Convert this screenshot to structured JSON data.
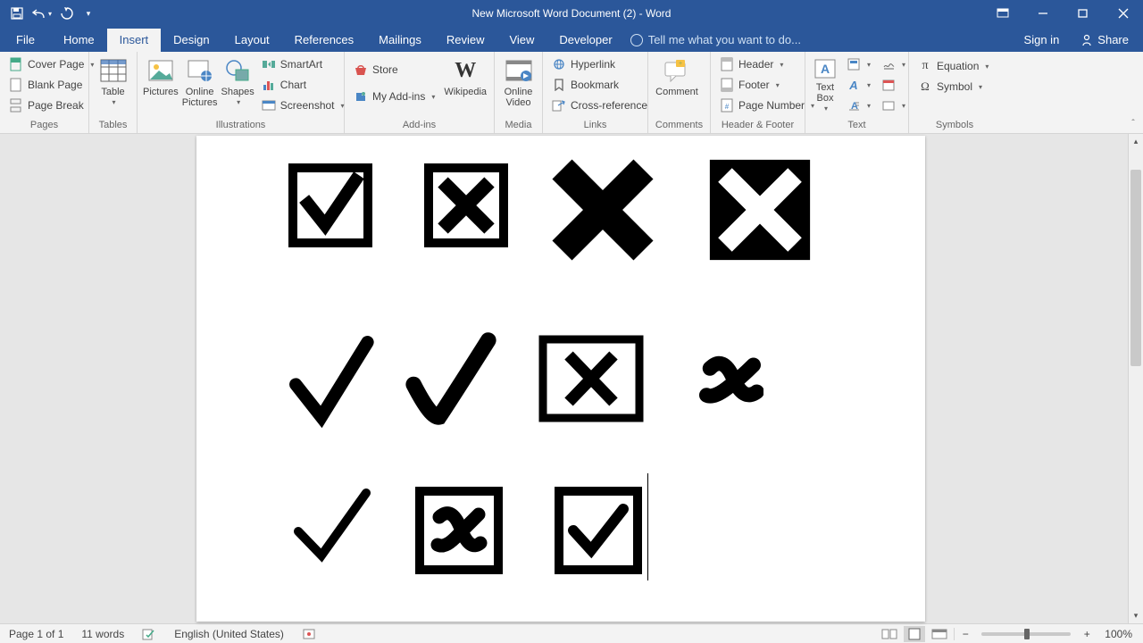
{
  "app": {
    "title": "New Microsoft Word Document (2) - Word"
  },
  "tabs": {
    "file": "File",
    "items": [
      "Home",
      "Insert",
      "Design",
      "Layout",
      "References",
      "Mailings",
      "Review",
      "View",
      "Developer"
    ],
    "active_index": 1,
    "tell_me_placeholder": "Tell me what you want to do...",
    "sign_in": "Sign in",
    "share": "Share"
  },
  "ribbon": {
    "pages": {
      "label": "Pages",
      "cover_page": "Cover Page",
      "blank_page": "Blank Page",
      "page_break": "Page Break"
    },
    "tables": {
      "label": "Tables",
      "table": "Table"
    },
    "illustrations": {
      "label": "Illustrations",
      "pictures": "Pictures",
      "online_pictures": "Online Pictures",
      "shapes": "Shapes",
      "smartart": "SmartArt",
      "chart": "Chart",
      "screenshot": "Screenshot"
    },
    "addins": {
      "label": "Add-ins",
      "store": "Store",
      "my_addins": "My Add-ins",
      "wikipedia": "Wikipedia"
    },
    "media": {
      "label": "Media",
      "online_video": "Online Video"
    },
    "links": {
      "label": "Links",
      "hyperlink": "Hyperlink",
      "bookmark": "Bookmark",
      "cross_reference": "Cross-reference"
    },
    "comments": {
      "label": "Comments",
      "comment": "Comment"
    },
    "header_footer": {
      "label": "Header & Footer",
      "header": "Header",
      "footer": "Footer",
      "page_number": "Page Number"
    },
    "text": {
      "label": "Text",
      "text_box": "Text Box"
    },
    "symbols": {
      "label": "Symbols",
      "equation": "Equation",
      "symbol": "Symbol"
    }
  },
  "document": {
    "symbols_row1": [
      "☑",
      "☒",
      "✖",
      "✘"
    ],
    "symbols_row2": [
      "✓",
      "✓",
      "☒",
      "✗"
    ],
    "symbols_row3": [
      "✓",
      "☒",
      "☑"
    ]
  },
  "status": {
    "page": "Page 1 of 1",
    "words": "11 words",
    "language": "English (United States)",
    "zoom": "100%"
  }
}
